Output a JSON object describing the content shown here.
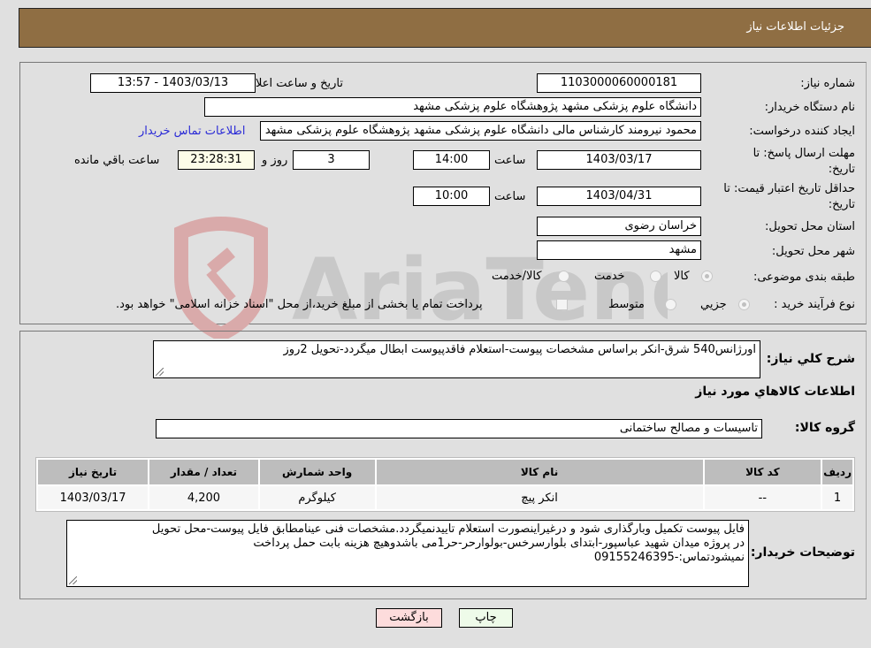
{
  "header": {
    "title": "جزئیات اطلاعات نیاز"
  },
  "form": {
    "need_number": {
      "label": "شماره نیاز:",
      "value": "1103000060000181"
    },
    "announce_datetime": {
      "label": "تاریخ و ساعت اعلان عمومي:",
      "value": "1403/03/13 - 13:57"
    },
    "buyer_org": {
      "label": "نام دستگاه خريدار:",
      "value": "دانشگاه علوم پزشکی مشهد   پژوهشگاه علوم پزشکی مشهد"
    },
    "requester": {
      "label": "ایجاد کننده درخواست:",
      "value": "محمود نیرومند کارشناس مالی دانشگاه علوم پزشکی مشهد   پژوهشگاه علوم پزشکی مشهد",
      "contact_link": "اطلاعات تماس خريدار"
    },
    "reply_deadline": {
      "label_line1": "مهلت ارسال پاسخ: تا",
      "label_line2": "تاریخ:",
      "date": "1403/03/17",
      "time_label": "ساعت",
      "time": "14:00",
      "days": "3",
      "days_label": "روز و",
      "remaining": "23:28:31",
      "remaining_label": "ساعت باقي مانده"
    },
    "price_validity": {
      "label_line1": "حداقل تاریخ اعتبار قیمت: تا",
      "label_line2": "تاریخ:",
      "date": "1403/04/31",
      "time_label": "ساعت",
      "time": "10:00"
    },
    "delivery_province": {
      "label": "استان محل تحویل:",
      "value": "خراسان رضوی"
    },
    "delivery_city": {
      "label": "شهر محل تحویل:",
      "value": "مشهد"
    },
    "category": {
      "label": "طبقه بندی موضوعی:",
      "options": [
        {
          "label": "کالا",
          "checked": true
        },
        {
          "label": "خدمت",
          "checked": false
        },
        {
          "label": "کالا/خدمت",
          "checked": false
        }
      ]
    },
    "purchase_type": {
      "label": "نوع فرآیند خرید :",
      "options": [
        {
          "label": "جزيي",
          "checked": true
        },
        {
          "label": "متوسط",
          "checked": false
        }
      ],
      "treasury_note": "پرداخت تمام یا بخشی از مبلغ خرید،از محل \"اسناد خزانه اسلامی\" خواهد بود."
    }
  },
  "details": {
    "summary_label": "شرح كلي نياز:",
    "summary_value": "اورژانس540 شرق-انکر براساس مشخصات پیوست-استعلام فاقدپیوست ابطال میگردد-تحویل 2روز",
    "goods_section_title": "اطلاعات كالاهاي مورد نياز",
    "goods_group_label": "گروه کالا:",
    "goods_group_value": "تاسیسات و مصالح ساختمانی",
    "table": {
      "columns": [
        "رديف",
        "کد کالا",
        "نام کالا",
        "واحد شمارش",
        "تعداد / مقدار",
        "تاریخ نیاز"
      ],
      "rows": [
        [
          "1",
          "--",
          "انکر پیچ",
          "کیلوگرم",
          "4,200",
          "1403/03/17"
        ]
      ]
    },
    "buyer_notes_label": "توضیحات خریدار:",
    "buyer_notes_lines": [
      "فایل پیوست تکمیل وبارگذاری شود و درغیراینصورت استعلام تاییدنمیگردد.مشخصات فنی عینامطابق فایل پیوست-محل تحویل",
      "در پروژه میدان شهید عباسپور-ابتدای بلوارسرخس-بولوارحر-حر1می باشدوهیچ هزینه بابت حمل  پرداخت",
      "نمیشودتماس:-09155246395"
    ]
  },
  "buttons": {
    "print": "چاپ",
    "back": "بازگشت"
  },
  "colors": {
    "header_bg": "#8f6e43",
    "print_bg": "#eefbe9",
    "back_bg": "#fddcdc",
    "link": "#2a2ad6"
  }
}
